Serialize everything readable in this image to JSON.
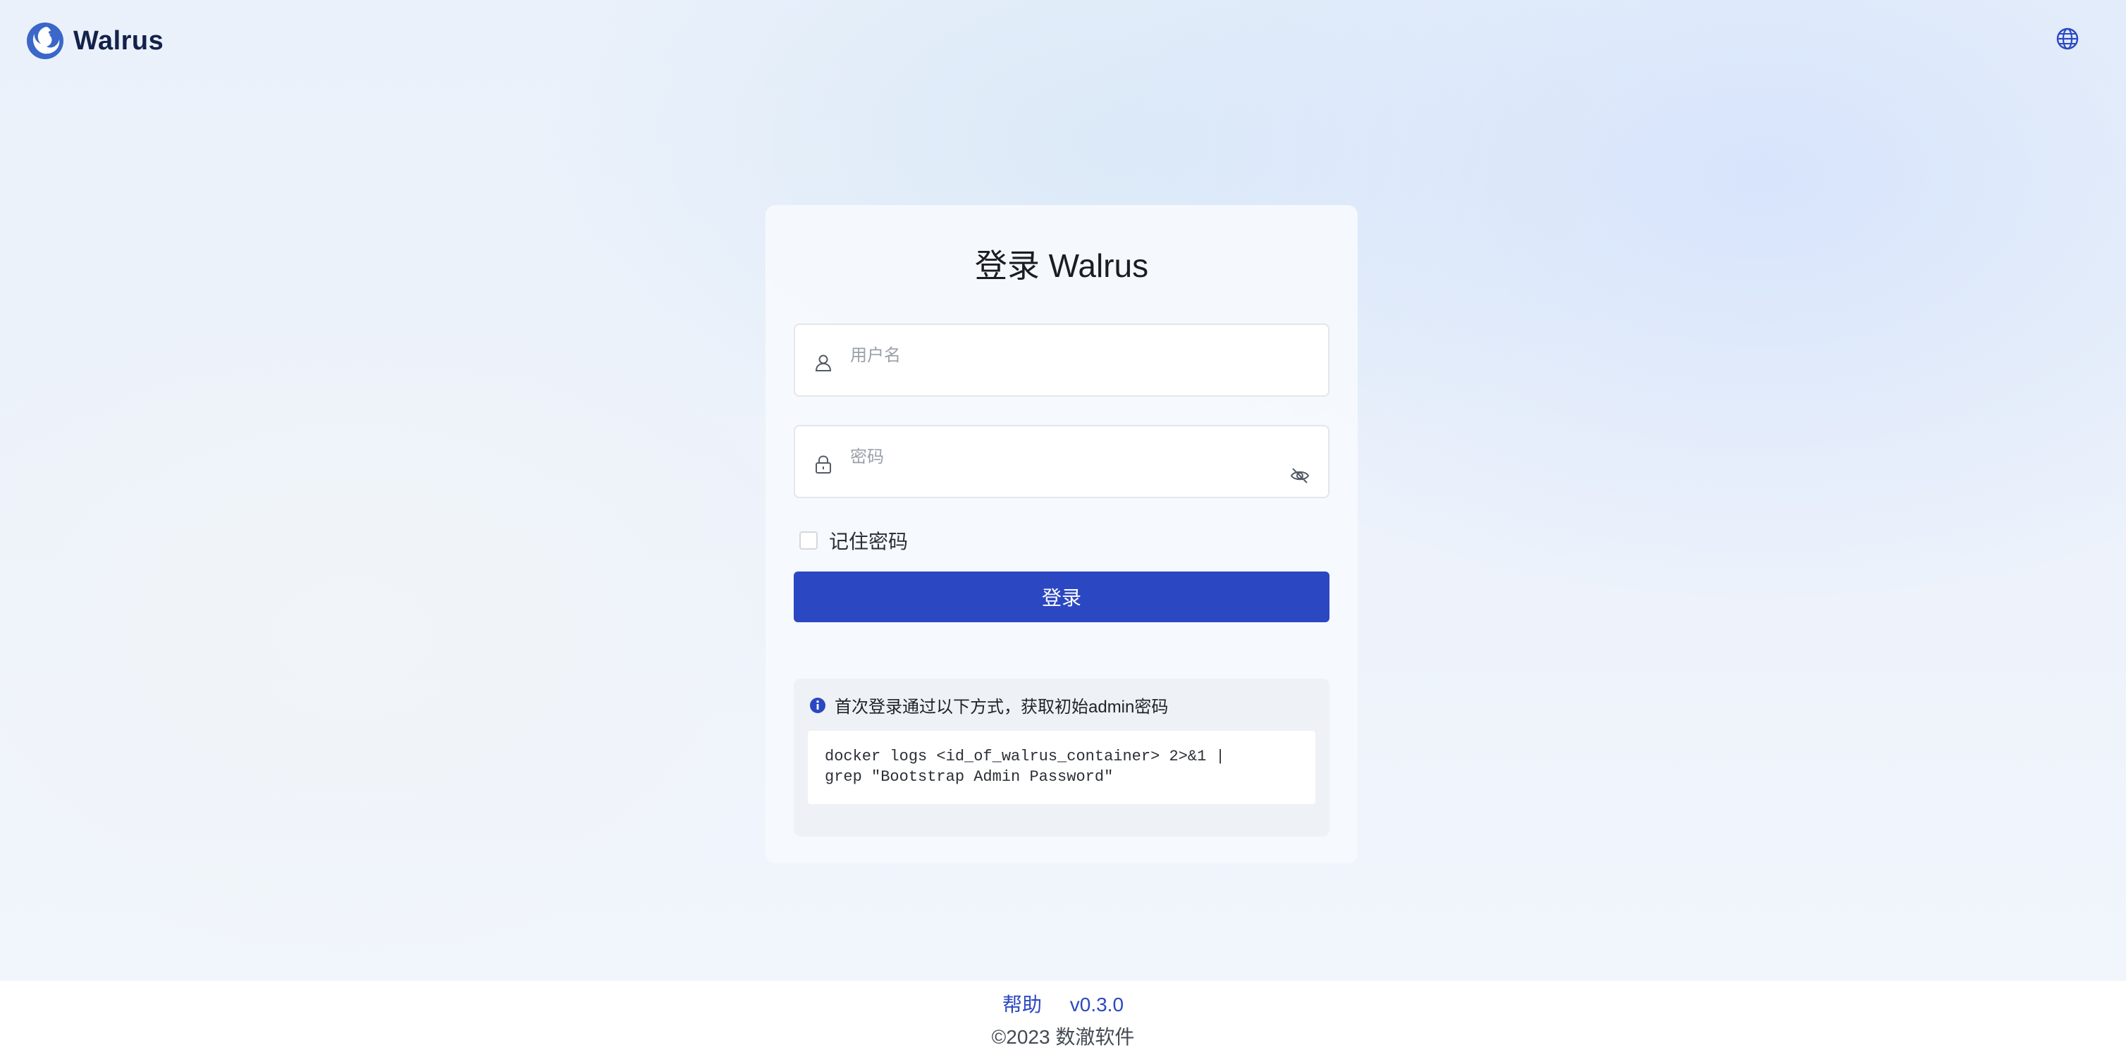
{
  "header": {
    "brand": "Walrus",
    "language_icon": "globe-icon"
  },
  "login": {
    "title": "登录 Walrus",
    "username_placeholder": "用户名",
    "password_placeholder": "密码",
    "remember_label": "记住密码",
    "submit_label": "登录"
  },
  "tip": {
    "text": "首次登录通过以下方式，获取初始admin密码",
    "command": "docker logs <id_of_walrus_container> 2>&1 |\ngrep \"Bootstrap Admin Password\""
  },
  "footer": {
    "help": "帮助",
    "version": "v0.3.0",
    "copyright": "©2023 数澈软件"
  },
  "colors": {
    "accent": "#2b48c2",
    "brand_text": "#14214a"
  }
}
